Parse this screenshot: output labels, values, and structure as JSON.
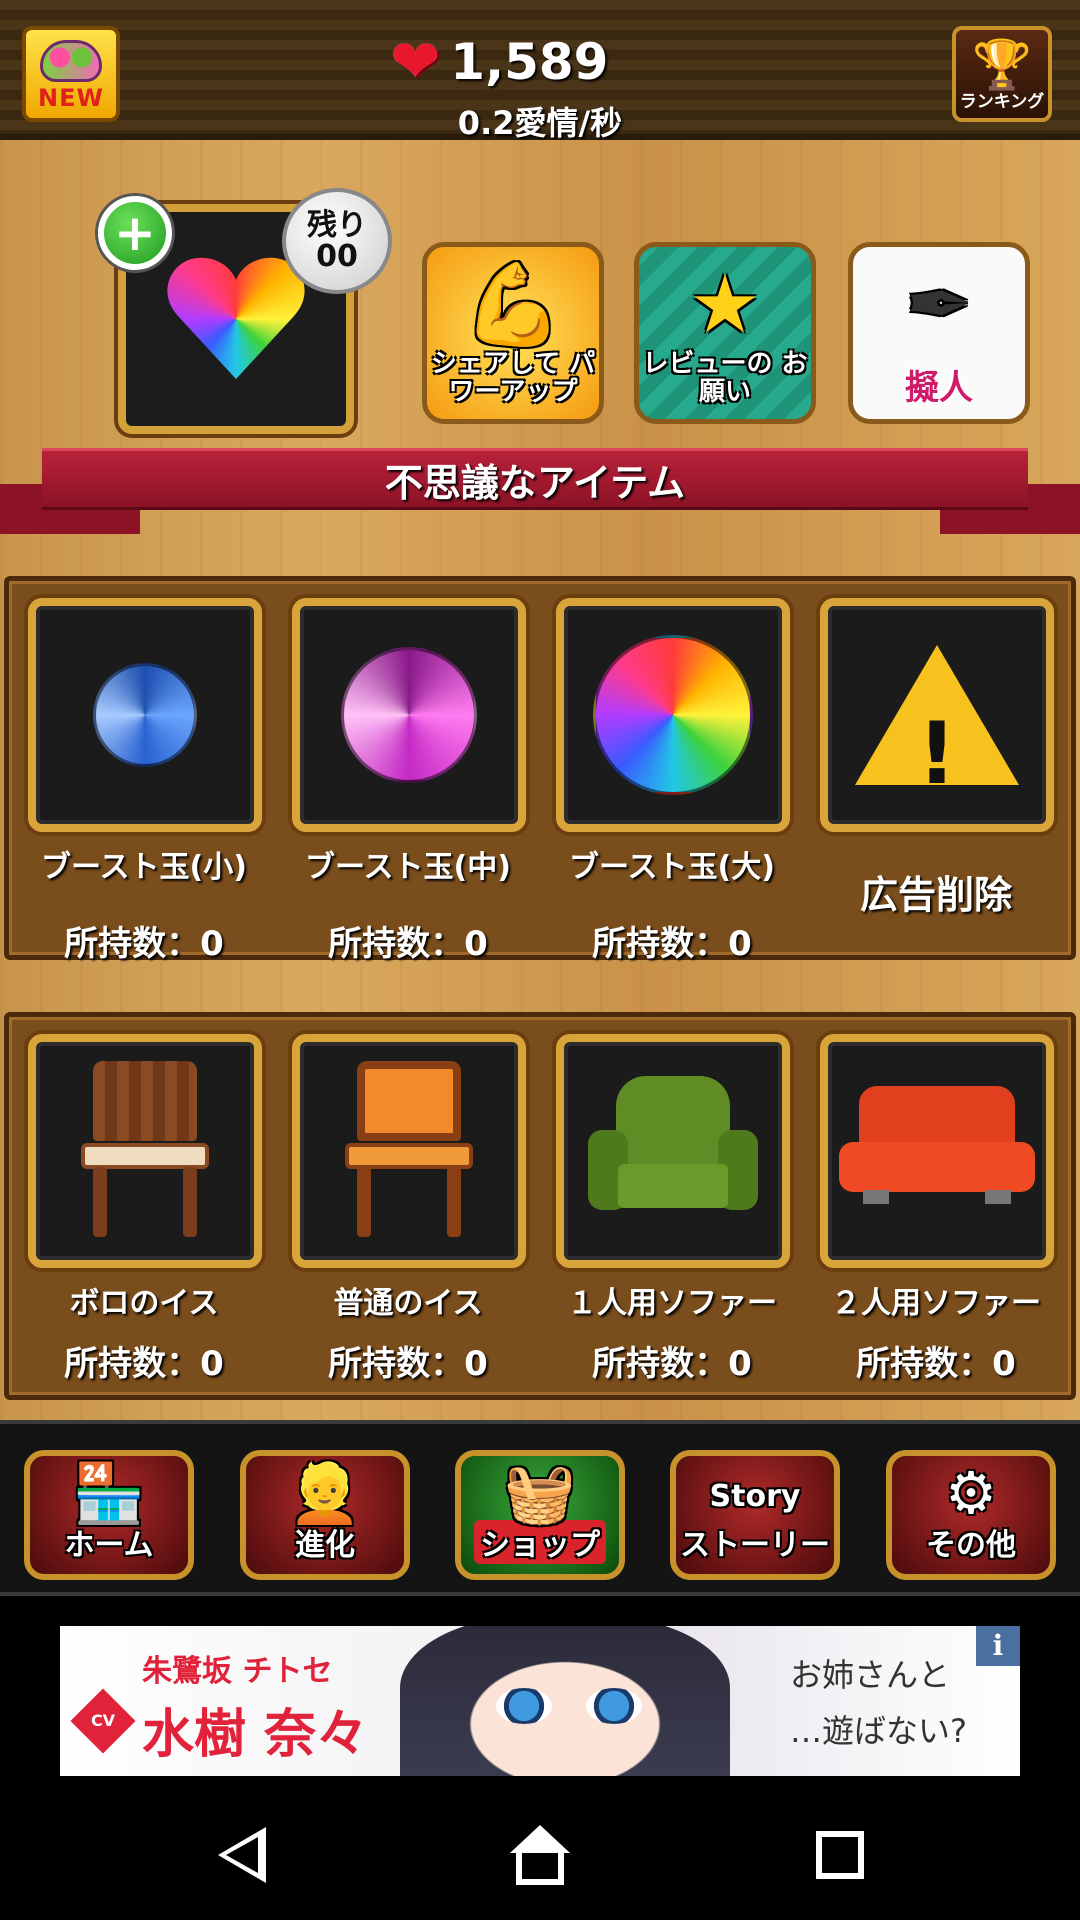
{
  "header": {
    "new_badge": "NEW",
    "love_total": "1,589",
    "love_rate": "0.2愛情/秒",
    "ranking_label": "ランキング"
  },
  "featured": {
    "remain_label": "残り",
    "remain_value": "00"
  },
  "promos": {
    "share_label": "シェアして パワーアップ",
    "review_label": "レビューの お願い",
    "gijin_label": "擬人"
  },
  "section_title": "不思議なアイテム",
  "items_row1": [
    {
      "name": "ブースト玉(小)",
      "owned": "所持数：0"
    },
    {
      "name": "ブースト玉(中)",
      "owned": "所持数：0"
    },
    {
      "name": "ブースト玉(大)",
      "owned": "所持数：0"
    },
    {
      "name": "広告削除"
    }
  ],
  "items_row2": [
    {
      "name": "ボロのイス",
      "owned": "所持数：0"
    },
    {
      "name": "普通のイス",
      "owned": "所持数：0"
    },
    {
      "name": "１人用ソファー",
      "owned": "所持数：0"
    },
    {
      "name": "２人用ソファー",
      "owned": "所持数：0"
    }
  ],
  "nav": {
    "home": "ホーム",
    "evolve": "進化",
    "shop": "ショップ",
    "story_art": "Story",
    "story": "ストーリー",
    "other": "その他",
    "active": "shop"
  },
  "ad": {
    "name_top": "朱鷺坂 チトセ",
    "cv_label": "CV",
    "name_main": "水樹 奈々",
    "line1": "お姉さんと",
    "line2": "…遊ばない?",
    "info": "i"
  },
  "colors": {
    "heart": "#e8182c",
    "banner_red": "#b8223a",
    "gold_frame": "#d9a43a",
    "panel_brown": "#7a4d1c"
  }
}
